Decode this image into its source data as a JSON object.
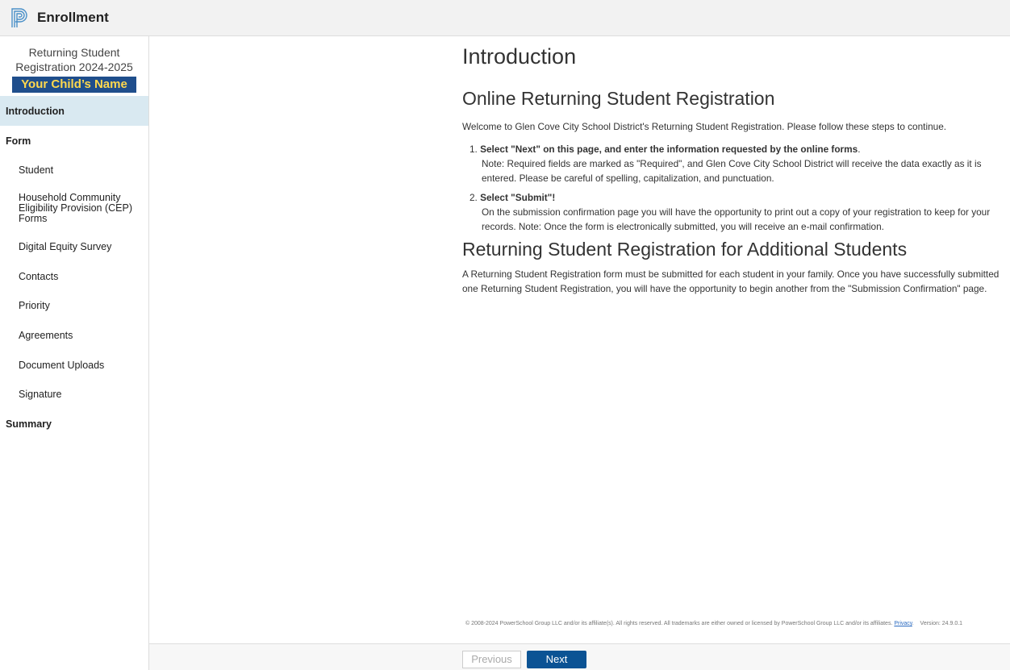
{
  "header": {
    "app_title": "Enrollment",
    "logo_icon": "powerschool-p-logo-icon"
  },
  "sidebar": {
    "reg_title_line1": "Returning Student",
    "reg_title_line2": "Registration 2024-2025",
    "child_name": "Your Child’s Name",
    "items": [
      {
        "label": "Introduction",
        "level": "top",
        "active": true
      },
      {
        "label": "Form",
        "level": "top"
      },
      {
        "label": "Student",
        "level": "sub"
      },
      {
        "label": "Household Community Eligibility Provision (CEP) Forms",
        "level": "sub"
      },
      {
        "label": "Digital Equity Survey",
        "level": "sub"
      },
      {
        "label": "Contacts",
        "level": "sub"
      },
      {
        "label": "Priority",
        "level": "sub"
      },
      {
        "label": "Agreements",
        "level": "sub"
      },
      {
        "label": "Document Uploads",
        "level": "sub"
      },
      {
        "label": "Signature",
        "level": "sub"
      },
      {
        "label": "Summary",
        "level": "top"
      }
    ]
  },
  "main": {
    "title": "Introduction",
    "section1_title": "Online Returning Student Registration",
    "welcome": "Welcome to Glen Cove City School District's Returning Student Registration.  Please follow these steps to continue.",
    "step1_num": "1.",
    "step1_title": "Select \"Next\" on this page, and enter the information requested by the online forms",
    "step1_body": "Note: Required fields are marked as \"Required\", and Glen Cove City School District will receive the data exactly as it is entered.  Please be careful of spelling, capitalization, and punctuation.",
    "step2_num": "2.",
    "step2_title": "Select \"Submit\"!",
    "step2_body": "On the submission confirmation page you will have the opportunity to print out a copy of your registration to keep for your records.  Note:  Once the form is electronically submitted, you will receive an e-mail confirmation.",
    "section2_title": "Returning Student Registration for Additional Students",
    "section2_body": "A Returning Student Registration form must be submitted for each student in your family. Once you have successfully submitted one Returning Student Registration, you will have the opportunity to begin another from the \"Submission Confirmation\" page."
  },
  "footer": {
    "copyright": "© 2008-2024 PowerSchool Group LLC and/or its affiliate(s). All rights reserved. All trademarks are either owned or licensed by PowerSchool Group LLC and/or its affiliates.",
    "privacy_label": "Privacy",
    "version": "Version: 24.9.0.1"
  },
  "buttons": {
    "previous": "Previous",
    "next": "Next"
  },
  "colors": {
    "active_nav_bg": "#d9e9f1",
    "primary_button": "#0b5394",
    "child_name_bg": "#1f4e8c",
    "child_name_text": "#ffd84d"
  }
}
